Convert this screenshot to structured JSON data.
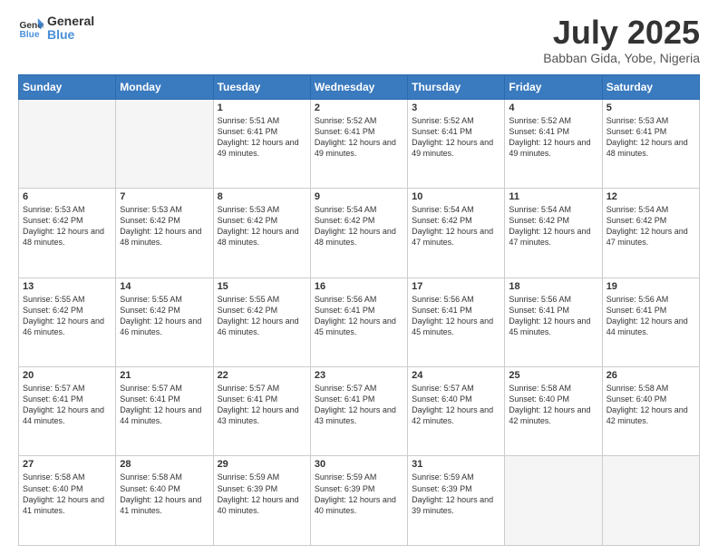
{
  "header": {
    "logo_line1": "General",
    "logo_line2": "Blue",
    "month": "July 2025",
    "location": "Babban Gida, Yobe, Nigeria"
  },
  "weekdays": [
    "Sunday",
    "Monday",
    "Tuesday",
    "Wednesday",
    "Thursday",
    "Friday",
    "Saturday"
  ],
  "weeks": [
    [
      {
        "day": "",
        "info": ""
      },
      {
        "day": "",
        "info": ""
      },
      {
        "day": "1",
        "info": "Sunrise: 5:51 AM\nSunset: 6:41 PM\nDaylight: 12 hours and 49 minutes."
      },
      {
        "day": "2",
        "info": "Sunrise: 5:52 AM\nSunset: 6:41 PM\nDaylight: 12 hours and 49 minutes."
      },
      {
        "day": "3",
        "info": "Sunrise: 5:52 AM\nSunset: 6:41 PM\nDaylight: 12 hours and 49 minutes."
      },
      {
        "day": "4",
        "info": "Sunrise: 5:52 AM\nSunset: 6:41 PM\nDaylight: 12 hours and 49 minutes."
      },
      {
        "day": "5",
        "info": "Sunrise: 5:53 AM\nSunset: 6:41 PM\nDaylight: 12 hours and 48 minutes."
      }
    ],
    [
      {
        "day": "6",
        "info": "Sunrise: 5:53 AM\nSunset: 6:42 PM\nDaylight: 12 hours and 48 minutes."
      },
      {
        "day": "7",
        "info": "Sunrise: 5:53 AM\nSunset: 6:42 PM\nDaylight: 12 hours and 48 minutes."
      },
      {
        "day": "8",
        "info": "Sunrise: 5:53 AM\nSunset: 6:42 PM\nDaylight: 12 hours and 48 minutes."
      },
      {
        "day": "9",
        "info": "Sunrise: 5:54 AM\nSunset: 6:42 PM\nDaylight: 12 hours and 48 minutes."
      },
      {
        "day": "10",
        "info": "Sunrise: 5:54 AM\nSunset: 6:42 PM\nDaylight: 12 hours and 47 minutes."
      },
      {
        "day": "11",
        "info": "Sunrise: 5:54 AM\nSunset: 6:42 PM\nDaylight: 12 hours and 47 minutes."
      },
      {
        "day": "12",
        "info": "Sunrise: 5:54 AM\nSunset: 6:42 PM\nDaylight: 12 hours and 47 minutes."
      }
    ],
    [
      {
        "day": "13",
        "info": "Sunrise: 5:55 AM\nSunset: 6:42 PM\nDaylight: 12 hours and 46 minutes."
      },
      {
        "day": "14",
        "info": "Sunrise: 5:55 AM\nSunset: 6:42 PM\nDaylight: 12 hours and 46 minutes."
      },
      {
        "day": "15",
        "info": "Sunrise: 5:55 AM\nSunset: 6:42 PM\nDaylight: 12 hours and 46 minutes."
      },
      {
        "day": "16",
        "info": "Sunrise: 5:56 AM\nSunset: 6:41 PM\nDaylight: 12 hours and 45 minutes."
      },
      {
        "day": "17",
        "info": "Sunrise: 5:56 AM\nSunset: 6:41 PM\nDaylight: 12 hours and 45 minutes."
      },
      {
        "day": "18",
        "info": "Sunrise: 5:56 AM\nSunset: 6:41 PM\nDaylight: 12 hours and 45 minutes."
      },
      {
        "day": "19",
        "info": "Sunrise: 5:56 AM\nSunset: 6:41 PM\nDaylight: 12 hours and 44 minutes."
      }
    ],
    [
      {
        "day": "20",
        "info": "Sunrise: 5:57 AM\nSunset: 6:41 PM\nDaylight: 12 hours and 44 minutes."
      },
      {
        "day": "21",
        "info": "Sunrise: 5:57 AM\nSunset: 6:41 PM\nDaylight: 12 hours and 44 minutes."
      },
      {
        "day": "22",
        "info": "Sunrise: 5:57 AM\nSunset: 6:41 PM\nDaylight: 12 hours and 43 minutes."
      },
      {
        "day": "23",
        "info": "Sunrise: 5:57 AM\nSunset: 6:41 PM\nDaylight: 12 hours and 43 minutes."
      },
      {
        "day": "24",
        "info": "Sunrise: 5:57 AM\nSunset: 6:40 PM\nDaylight: 12 hours and 42 minutes."
      },
      {
        "day": "25",
        "info": "Sunrise: 5:58 AM\nSunset: 6:40 PM\nDaylight: 12 hours and 42 minutes."
      },
      {
        "day": "26",
        "info": "Sunrise: 5:58 AM\nSunset: 6:40 PM\nDaylight: 12 hours and 42 minutes."
      }
    ],
    [
      {
        "day": "27",
        "info": "Sunrise: 5:58 AM\nSunset: 6:40 PM\nDaylight: 12 hours and 41 minutes."
      },
      {
        "day": "28",
        "info": "Sunrise: 5:58 AM\nSunset: 6:40 PM\nDaylight: 12 hours and 41 minutes."
      },
      {
        "day": "29",
        "info": "Sunrise: 5:59 AM\nSunset: 6:39 PM\nDaylight: 12 hours and 40 minutes."
      },
      {
        "day": "30",
        "info": "Sunrise: 5:59 AM\nSunset: 6:39 PM\nDaylight: 12 hours and 40 minutes."
      },
      {
        "day": "31",
        "info": "Sunrise: 5:59 AM\nSunset: 6:39 PM\nDaylight: 12 hours and 39 minutes."
      },
      {
        "day": "",
        "info": ""
      },
      {
        "day": "",
        "info": ""
      }
    ]
  ]
}
